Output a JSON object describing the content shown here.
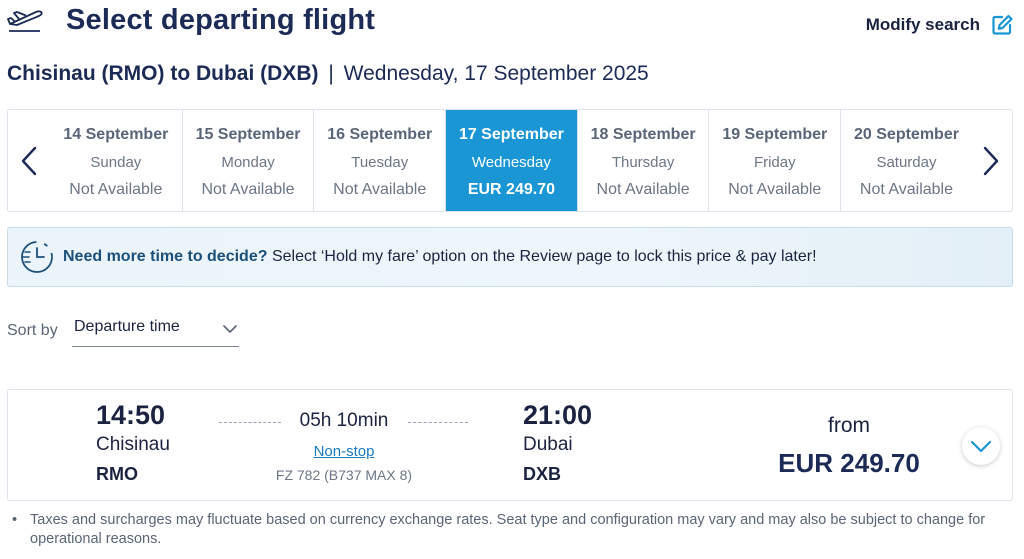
{
  "header": {
    "title": "Select departing flight",
    "modify_label": "Modify search",
    "route": "Chisinau (RMO) to Dubai (DXB)",
    "separator": "|",
    "date": "Wednesday, 17 September 2025"
  },
  "date_strip": {
    "days": [
      {
        "date": "14 September",
        "weekday": "Sunday",
        "price": "Not Available",
        "selected": false
      },
      {
        "date": "15 September",
        "weekday": "Monday",
        "price": "Not Available",
        "selected": false
      },
      {
        "date": "16 September",
        "weekday": "Tuesday",
        "price": "Not Available",
        "selected": false
      },
      {
        "date": "17 September",
        "weekday": "Wednesday",
        "price": "EUR 249.70",
        "selected": true
      },
      {
        "date": "18 September",
        "weekday": "Thursday",
        "price": "Not Available",
        "selected": false
      },
      {
        "date": "19 September",
        "weekday": "Friday",
        "price": "Not Available",
        "selected": false
      },
      {
        "date": "20 September",
        "weekday": "Saturday",
        "price": "Not Available",
        "selected": false
      }
    ]
  },
  "hold_banner": {
    "bold_text": "Need more time to decide?",
    "text": "Select ‘Hold my fare’ option on the Review page to lock this price & pay later!"
  },
  "sort": {
    "label": "Sort by",
    "value": "Departure time"
  },
  "flight": {
    "dep_time": "14:50",
    "dep_city": "Chisinau",
    "dep_code": "RMO",
    "duration": "05h 10min",
    "stops": "Non-stop",
    "flight_no": "FZ 782 (B737 MAX 8)",
    "arr_time": "21:00",
    "arr_city": "Dubai",
    "arr_code": "DXB",
    "from_label": "from",
    "price": "EUR 249.70"
  },
  "footnote": {
    "bullet": "•",
    "text": "Taxes and surcharges may fluctuate based on currency exchange rates. Seat type and configuration may vary and may also be subject to change for operational reasons."
  },
  "colors": {
    "accent": "#1a96d4",
    "navy": "#1c2a56",
    "link": "#1a7bc0"
  },
  "icons": {
    "title": "plane-departure-icon",
    "modify": "edit-icon",
    "banner": "clock-icon",
    "prev": "chevron-left-icon",
    "next": "chevron-right-icon",
    "sort": "chevron-down-icon",
    "expand": "chevron-down-icon"
  }
}
